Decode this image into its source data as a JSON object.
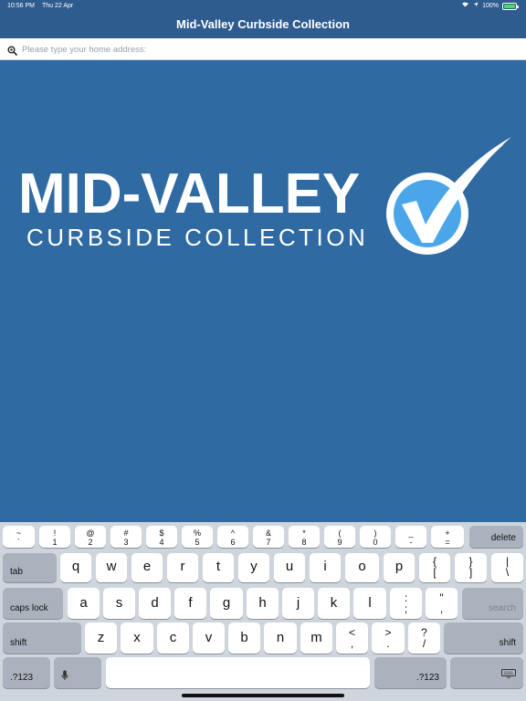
{
  "status_bar": {
    "time": "10:56 PM",
    "date": "Thu 22 Apr",
    "battery": "100%"
  },
  "header": {
    "title": "Mid-Valley Curbside Collection"
  },
  "search": {
    "placeholder": "Please type your home address:"
  },
  "logo": {
    "title": "MID-VALLEY",
    "subtitle": "CURBSIDE COLLECTION",
    "check_color": "#4aa6e8"
  },
  "keyboard": {
    "row1": [
      {
        "top": "~",
        "bottom": "`"
      },
      {
        "top": "!",
        "bottom": "1"
      },
      {
        "top": "@",
        "bottom": "2"
      },
      {
        "top": "#",
        "bottom": "3"
      },
      {
        "top": "$",
        "bottom": "4"
      },
      {
        "top": "%",
        "bottom": "5"
      },
      {
        "top": "^",
        "bottom": "6"
      },
      {
        "top": "&",
        "bottom": "7"
      },
      {
        "top": "*",
        "bottom": "8"
      },
      {
        "top": "(",
        "bottom": "9"
      },
      {
        "top": ")",
        "bottom": "0"
      },
      {
        "top": "_",
        "bottom": "-"
      },
      {
        "top": "+",
        "bottom": "="
      }
    ],
    "delete": "delete",
    "tab": "tab",
    "row2": [
      "q",
      "w",
      "e",
      "r",
      "t",
      "y",
      "u",
      "i",
      "o",
      "p"
    ],
    "row2_sym": [
      {
        "top": "{",
        "bottom": "["
      },
      {
        "top": "}",
        "bottom": "]"
      },
      {
        "top": "|",
        "bottom": "\\"
      }
    ],
    "caps_lock": "caps lock",
    "row3": [
      "a",
      "s",
      "d",
      "f",
      "g",
      "h",
      "j",
      "k",
      "l"
    ],
    "row3_sym": [
      {
        "top": ":",
        "bottom": ";"
      },
      {
        "top": "\"",
        "bottom": ","
      }
    ],
    "search": "search",
    "shift_left": "shift",
    "row4": [
      "z",
      "x",
      "c",
      "v",
      "b",
      "n",
      "m"
    ],
    "row4_sym": [
      {
        "top": "<",
        "bottom": ","
      },
      {
        "top": ">",
        "bottom": "."
      },
      {
        "top": "?",
        "bottom": "/"
      }
    ],
    "shift_right": "shift",
    "numbers_left": ".?123",
    "numbers_right": ".?123"
  },
  "colors": {
    "background": "#2f6aa3",
    "header": "#2e5c8f",
    "keyboard": "#cfd5dd"
  }
}
